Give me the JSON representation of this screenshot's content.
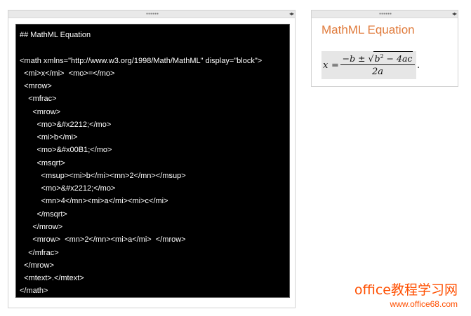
{
  "code_panel": {
    "lines": [
      "## MathML Equation",
      "",
      "<math xmlns=\"http://www.w3.org/1998/Math/MathML\" display=\"block\">",
      "  <mi>x</mi>  <mo>=</mo>",
      "  <mrow>",
      "    <mfrac>",
      "      <mrow>",
      "        <mo>&#x2212;</mo>",
      "        <mi>b</mi>",
      "        <mo>&#x00B1;</mo>",
      "        <msqrt>",
      "          <msup><mi>b</mi><mn>2</mn></msup>",
      "          <mo>&#x2212;</mo>",
      "          <mn>4</mn><mi>a</mi><mi>c</mi>",
      "        </msqrt>",
      "      </mrow>",
      "      <mrow>  <mn>2</mn><mi>a</mi>  </mrow>",
      "    </mfrac>",
      "  </mrow>",
      "  <mtext>.</mtext>",
      "</math>"
    ]
  },
  "result_panel": {
    "title": "MathML Equation",
    "formula": {
      "lhs": "x",
      "eq": "=",
      "num_prefix": "−b ± ",
      "sqrt_base": "b",
      "sqrt_exp": "2",
      "sqrt_rest": " − 4ac",
      "den": "2a",
      "period": "."
    }
  },
  "watermark": {
    "main": "office教程学习网",
    "url": "www.office68.com"
  },
  "colors": {
    "title": "#e07b3c",
    "watermark": "#ff4f00",
    "code_bg": "#000000",
    "code_fg": "#ffffff"
  }
}
